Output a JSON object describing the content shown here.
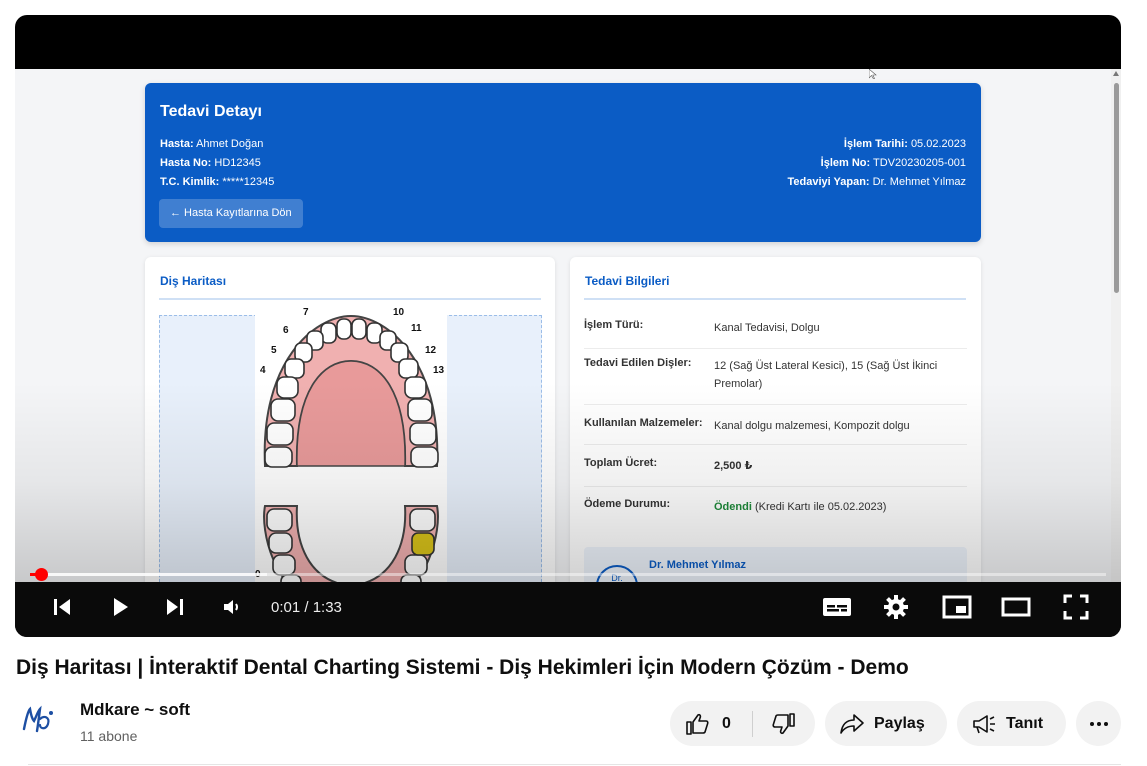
{
  "video": {
    "header": {
      "title": "Tedavi Detayı",
      "patient_label": "Hasta:",
      "patient_value": "Ahmet Doğan",
      "patient_no_label": "Hasta No:",
      "patient_no_value": "HD12345",
      "tc_label": "T.C. Kimlik:",
      "tc_value": "*****12345",
      "date_label": "İşlem Tarihi:",
      "date_value": "05.02.2023",
      "op_no_label": "İşlem No:",
      "op_no_value": "TDV20230205-001",
      "doctor_label": "Tedaviyi Yapan:",
      "doctor_value": "Dr. Mehmet Yılmaz",
      "back_button": "← Hasta Kayıtlarına Dön"
    },
    "chart_card": {
      "title": "Diş Haritası",
      "tooth_numbers": [
        "7",
        "10",
        "6",
        "11",
        "5",
        "12",
        "4",
        "13",
        "0"
      ]
    },
    "treatment_card": {
      "title": "Tedavi Bilgileri",
      "rows": [
        {
          "label": "İşlem Türü:",
          "value": "Kanal Tedavisi, Dolgu"
        },
        {
          "label": "Tedavi Edilen Dişler:",
          "value": "12 (Sağ Üst Lateral Kesici), 15 (Sağ Üst İkinci Premolar)"
        },
        {
          "label": "Kullanılan Malzemeler:",
          "value": "Kanal dolgu malzemesi, Kompozit dolgu"
        },
        {
          "label": "Toplam Ücret:",
          "value": "2,500 ₺"
        },
        {
          "label": "Ödeme Durumu:",
          "value_status": "Ödendi",
          "value_rest": "(Kredi Kartı ile 05.02.2023)"
        }
      ],
      "doctor_name": "Dr. Mehmet Yılmaz",
      "doctor_avatar_text": "Dr."
    }
  },
  "player": {
    "time_current": "0:01",
    "time_total": "1:33",
    "time_display": "0:01 / 1:33",
    "progress_played": 0.011,
    "progress_loaded": 0.22,
    "icons": [
      "previous-icon",
      "play-icon",
      "next-icon",
      "volume-icon",
      "subtitles-icon",
      "settings-gear-icon",
      "miniplayer-icon",
      "theater-mode-icon",
      "fullscreen-icon"
    ]
  },
  "page": {
    "title": "Diş Haritası | İnteraktif Dental Charting Sistemi - Diş Hekimleri İçin Modern Çözüm - Demo",
    "channel_name": "Mdkare ~ soft",
    "subscribers": "11 abone",
    "like_count": "0",
    "share_label": "Paylaş",
    "clip_label": "Tanıt",
    "colors": {
      "brand_red": "#ff0000",
      "header_blue": "#0b5cc5",
      "paid_green": "#1e8a3a"
    }
  }
}
